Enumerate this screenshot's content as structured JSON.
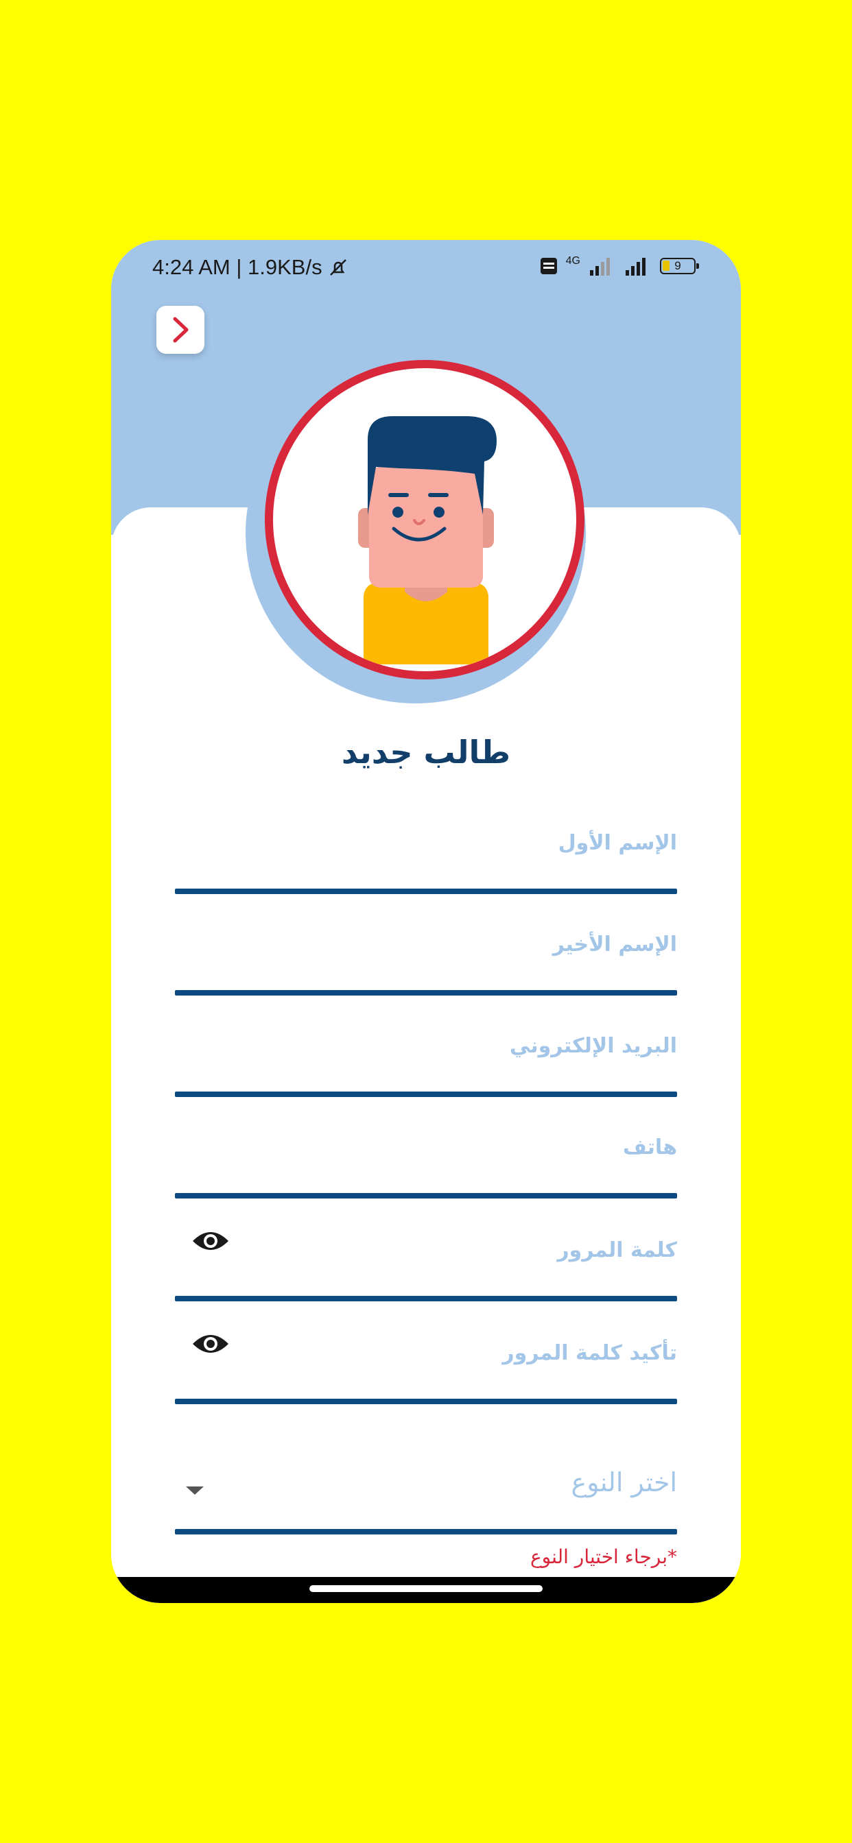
{
  "statusbar": {
    "time_speed": "4:24 AM | 1.9KB/s",
    "network": "4G",
    "battery": "9"
  },
  "header": {
    "back_icon": "chevron-right-icon"
  },
  "page": {
    "title": "طالب جديد"
  },
  "form": {
    "first_name_label": "الإسم الأول",
    "last_name_label": "الإسم الأخير",
    "email_label": "البريد الإلكتروني",
    "phone_label": "هاتف",
    "password_label": "كلمة المرور",
    "confirm_password_label": "تأكيد كلمة المرور",
    "gender_placeholder": "اختر النوع",
    "gender_error": "*برجاء اختيار النوع"
  },
  "colors": {
    "background": "#FFFF00",
    "header": "#A3C6E8",
    "accent": "#0E4A82",
    "ring": "#D8263A",
    "label": "#A3C6E8"
  }
}
